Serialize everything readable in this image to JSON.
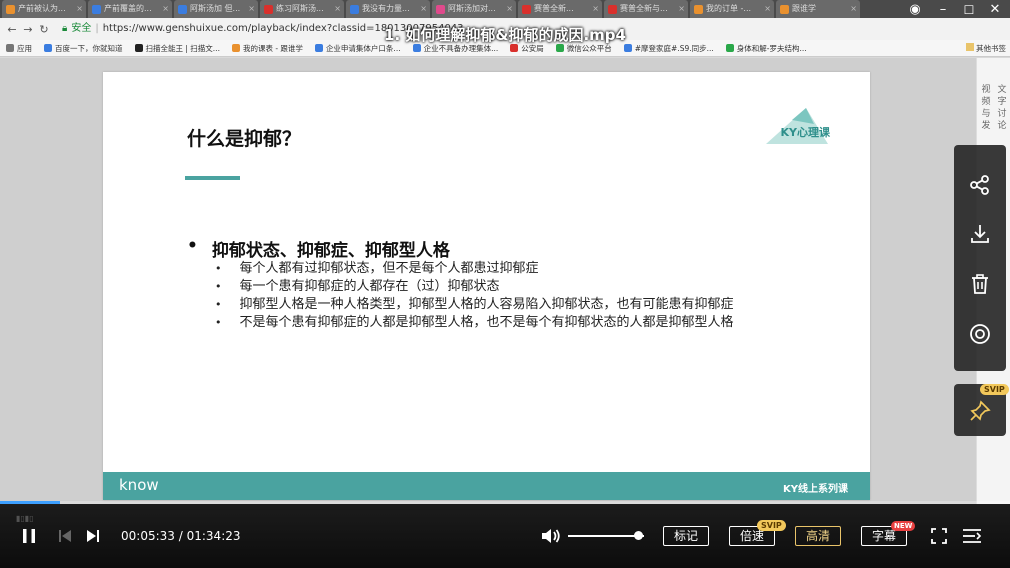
{
  "browser": {
    "tabs": [
      {
        "label": "产前被认为...",
        "color": "#e9912f"
      },
      {
        "label": "产前覆盖的...",
        "color": "#3b7de0"
      },
      {
        "label": "阿斯汤加 但...",
        "color": "#3b7de0"
      },
      {
        "label": "练习阿斯汤...",
        "color": "#d9302c"
      },
      {
        "label": "我没有力量...",
        "color": "#3b7de0"
      },
      {
        "label": "阿斯汤加对...",
        "color": "#e04a8c"
      },
      {
        "label": "赛普全新...",
        "color": "#d9302c"
      },
      {
        "label": "赛普全新与...",
        "color": "#d9302c"
      },
      {
        "label": "我的订单 -...",
        "color": "#e9912f"
      },
      {
        "label": "跟谁学",
        "color": "#e9912f"
      }
    ],
    "window_controls": {
      "minimize": "–",
      "maximize": "☐",
      "close": "✕"
    },
    "secure_label": "安全",
    "url": "https://www.genshuixue.com/playback/index?classid=18013007954043",
    "bookmarks": [
      {
        "label": "应用",
        "color": "#777"
      },
      {
        "label": "百度一下，你就知道",
        "color": "#3b7de0"
      },
      {
        "label": "扫描全能王 | 扫描文...",
        "color": "#222"
      },
      {
        "label": "我的课表 - 跟谁学",
        "color": "#e9912f"
      },
      {
        "label": "企业申请集体户口条...",
        "color": "#3b7de0"
      },
      {
        "label": "企业不具备办理集体...",
        "color": "#3b7de0"
      },
      {
        "label": "公安局",
        "color": "#d9302c"
      },
      {
        "label": "微信公众平台",
        "color": "#2aa84a"
      },
      {
        "label": "#摩登家庭#.S9.同步...",
        "color": "#3b7de0"
      },
      {
        "label": "身体和解-罗夫结构...",
        "color": "#2aa84a"
      }
    ],
    "bookmarks_other": "其他书签"
  },
  "video": {
    "title": "1. 如何理解抑郁&抑郁的成因.mp4"
  },
  "slide": {
    "title": "什么是抑郁？",
    "logo_text": "KY心理课",
    "main_bullet": "抑郁状态、抑郁症、抑郁型人格",
    "sub_bullets": [
      "每个人都有过抑郁状态，但不是每个人都患过抑郁症",
      "每一个患有抑郁症的人都存在（过）抑郁状态",
      "抑郁型人格是一种人格类型，抑郁型人格的人容易陷入抑郁状态，也有可能患有抑郁症",
      "不是每个患有抑郁症的人都是抑郁型人格，也不是每个有抑郁状态的人都是抑郁型人格"
    ],
    "footer_left": "know",
    "footer_right": "KY线上系列课"
  },
  "side_panel": {
    "tab1": "视频与发",
    "tab2": "文字讨论"
  },
  "float_tools": {
    "icons": [
      "share-icon",
      "download-icon",
      "delete-icon",
      "target-icon"
    ],
    "pin_badge": "SVIP"
  },
  "player": {
    "current_time": "00:05:33",
    "separator": "/",
    "total_time": "01:34:23",
    "progress_fraction": 0.059,
    "volume_fraction": 0.87,
    "buttons": {
      "mark": "标记",
      "speed": "倍速",
      "speed_badge": "SVIP",
      "quality": "高清",
      "subtitle": "字幕",
      "subtitle_badge": "NEW"
    }
  },
  "accent_colors": {
    "teal": "#4aa3a0",
    "progress": "#3da0ff",
    "gold": "#e9c46a"
  }
}
